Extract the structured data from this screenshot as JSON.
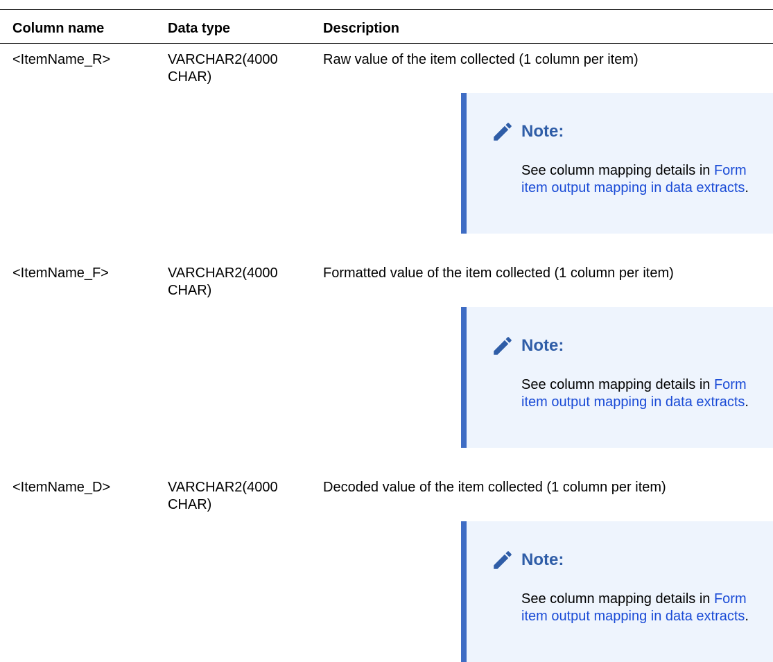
{
  "table": {
    "headers": {
      "column_name": "Column name",
      "data_type": "Data type",
      "description": "Description"
    },
    "rows": [
      {
        "column_name": "<ItemName_R>",
        "data_type": "VARCHAR2(4000 CHAR)",
        "description": "Raw value of the item collected (1 column per item)",
        "note": {
          "title": "Note:",
          "text": "See column mapping details in ",
          "link": "Form item output mapping in data extracts",
          "end": "."
        }
      },
      {
        "column_name": "<ItemName_F>",
        "data_type": "VARCHAR2(4000 CHAR)",
        "description": "Formatted value of the item collected (1 column per item)",
        "note": {
          "title": "Note:",
          "text": "See column mapping details in ",
          "link": "Form item output mapping in data extracts",
          "end": "."
        }
      },
      {
        "column_name": "<ItemName_D>",
        "data_type": "VARCHAR2(4000 CHAR)",
        "description": "Decoded value of the item collected (1 column per item)",
        "note": {
          "title": "Note:",
          "text": "See column mapping details in ",
          "link": "Form item output mapping in data extracts",
          "end": "."
        }
      }
    ]
  },
  "icons": {
    "note": "pencil-icon"
  },
  "colors": {
    "note_background": "#eef4fd",
    "note_border": "#3e6cc4",
    "note_title": "#2f5da7",
    "link": "#1a4bd6"
  }
}
